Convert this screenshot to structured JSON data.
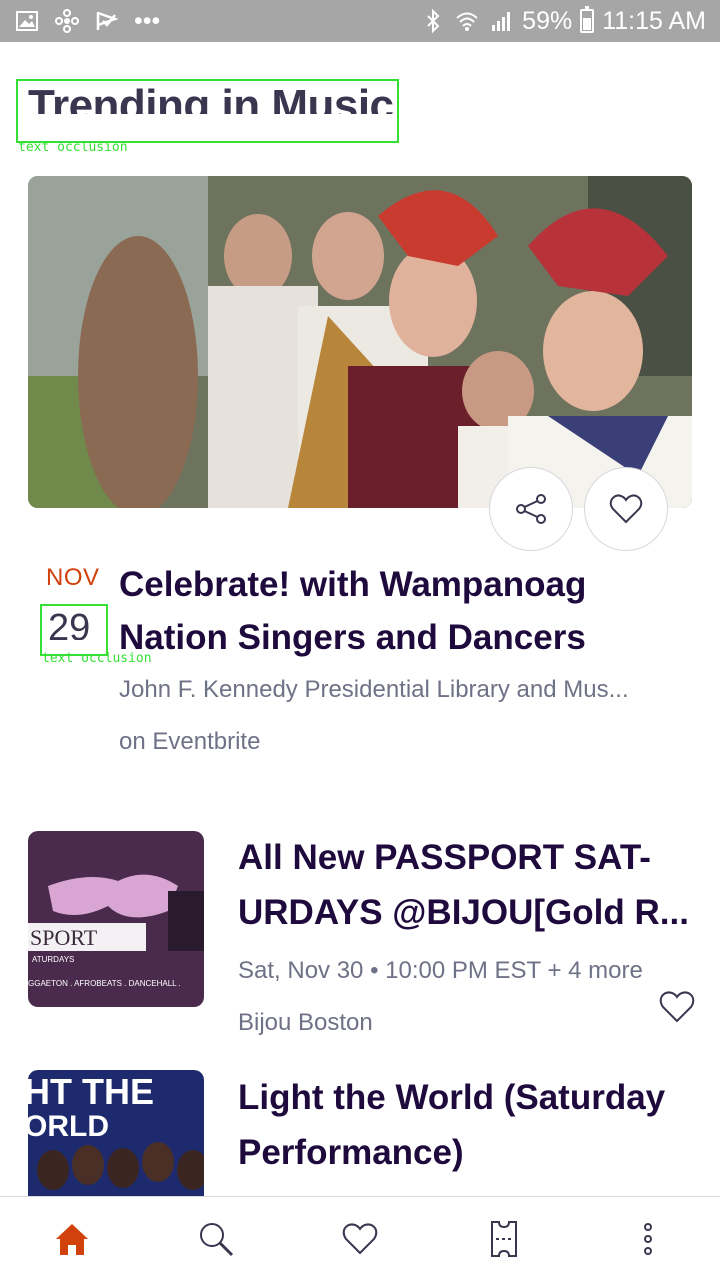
{
  "status_bar": {
    "dots": "•••",
    "battery": "59%",
    "time": "11:15 AM",
    "icons": [
      "gallery-icon",
      "pinwheel-icon",
      "flag-icon",
      "bluetooth-icon",
      "wifi-icon",
      "signal-icon",
      "battery-icon"
    ]
  },
  "section": {
    "title": "Trending in Music",
    "occlusion_label": "text occlusion"
  },
  "hero": {
    "month": "NOV",
    "day": "29",
    "occlusion_label": "text occlusion",
    "title": "Celebrate! with Wampanoag Nation Singers and Dancers",
    "venue": "John F. Kennedy Presidential Library and Mus...",
    "organizer": "on Eventbrite",
    "share_icon": "share-icon",
    "like_icon": "heart-icon"
  },
  "events": [
    {
      "title": "All New PASSPORT SAT-URDAYS @BIJOU[Gold R...",
      "datetime": "Sat, Nov 30 • 10:00 PM EST + 4 more",
      "venue": "Bijou Boston",
      "thumb_text": "SPORT",
      "thumb_sub": "ATURDAYS",
      "thumb_genres": "GGAETON . AFROBEATS . DANCEHALL ."
    },
    {
      "title": "Light the World (Saturday Performance)",
      "thumb_text": "HT THE",
      "thumb_sub": "ORLD"
    }
  ],
  "nav": [
    "home-icon",
    "search-icon",
    "heart-icon",
    "ticket-icon",
    "more-icon"
  ],
  "colors": {
    "accent": "#d1410c",
    "title": "#1e0a3c",
    "secondary": "#6f7287",
    "status_bar": "#a6a6a6"
  }
}
